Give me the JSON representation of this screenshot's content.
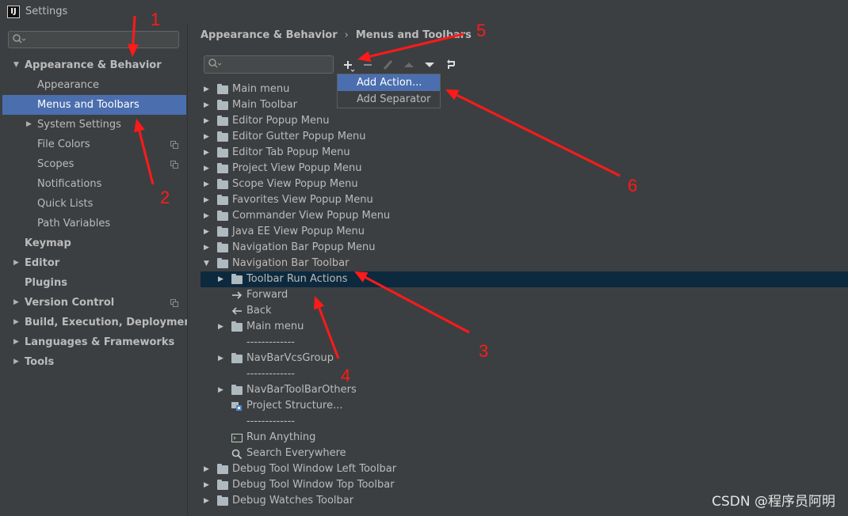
{
  "window": {
    "title": "Settings",
    "logo": "IJ"
  },
  "sidebar": {
    "search_placeholder": "",
    "items": [
      {
        "label": "Appearance & Behavior",
        "level": 0,
        "bold": true,
        "expand": "expanded"
      },
      {
        "label": "Appearance",
        "level": 1
      },
      {
        "label": "Menus and Toolbars",
        "level": 1,
        "selected": true
      },
      {
        "label": "System Settings",
        "level": 1,
        "expand": "collapsed"
      },
      {
        "label": "File Colors",
        "level": 1,
        "badge": true
      },
      {
        "label": "Scopes",
        "level": 1,
        "badge": true
      },
      {
        "label": "Notifications",
        "level": 1
      },
      {
        "label": "Quick Lists",
        "level": 1
      },
      {
        "label": "Path Variables",
        "level": 1
      },
      {
        "label": "Keymap",
        "level": 0,
        "bold": true
      },
      {
        "label": "Editor",
        "level": 0,
        "bold": true,
        "expand": "collapsed"
      },
      {
        "label": "Plugins",
        "level": 0,
        "bold": true
      },
      {
        "label": "Version Control",
        "level": 0,
        "bold": true,
        "expand": "collapsed",
        "badge": true
      },
      {
        "label": "Build, Execution, Deployment",
        "level": 0,
        "bold": true,
        "expand": "collapsed"
      },
      {
        "label": "Languages & Frameworks",
        "level": 0,
        "bold": true,
        "expand": "collapsed"
      },
      {
        "label": "Tools",
        "level": 0,
        "bold": true,
        "expand": "collapsed"
      }
    ]
  },
  "breadcrumb": {
    "parent": "Appearance & Behavior",
    "separator": "›",
    "current": "Menus and Toolbars"
  },
  "toolbar": {
    "buttons": [
      "plus-icon",
      "minus-icon",
      "edit-icon",
      "move-up-icon",
      "move-down-icon",
      "restore-icon"
    ]
  },
  "popup": {
    "items": [
      {
        "label": "Add Action...",
        "highlighted": true
      },
      {
        "label": "Add Separator"
      }
    ]
  },
  "tree": [
    {
      "label": "Main menu",
      "level": 0,
      "type": "folder",
      "expand": "collapsed"
    },
    {
      "label": "Main Toolbar",
      "level": 0,
      "type": "folder",
      "expand": "collapsed"
    },
    {
      "label": "Editor Popup Menu",
      "level": 0,
      "type": "folder",
      "expand": "collapsed"
    },
    {
      "label": "Editor Gutter Popup Menu",
      "level": 0,
      "type": "folder",
      "expand": "collapsed"
    },
    {
      "label": "Editor Tab Popup Menu",
      "level": 0,
      "type": "folder",
      "expand": "collapsed"
    },
    {
      "label": "Project View Popup Menu",
      "level": 0,
      "type": "folder",
      "expand": "collapsed"
    },
    {
      "label": "Scope View Popup Menu",
      "level": 0,
      "type": "folder",
      "expand": "collapsed"
    },
    {
      "label": "Favorites View Popup Menu",
      "level": 0,
      "type": "folder",
      "expand": "collapsed"
    },
    {
      "label": "Commander View Popup Menu",
      "level": 0,
      "type": "folder",
      "expand": "collapsed"
    },
    {
      "label": "Java EE View Popup Menu",
      "level": 0,
      "type": "folder",
      "expand": "collapsed"
    },
    {
      "label": "Navigation Bar Popup Menu",
      "level": 0,
      "type": "folder",
      "expand": "collapsed"
    },
    {
      "label": "Navigation Bar Toolbar",
      "level": 0,
      "type": "folder",
      "expand": "expanded"
    },
    {
      "label": "Toolbar Run Actions",
      "level": 1,
      "type": "folder",
      "expand": "collapsed",
      "selected": true
    },
    {
      "label": "Forward",
      "level": 1,
      "type": "forward"
    },
    {
      "label": "Back",
      "level": 1,
      "type": "back"
    },
    {
      "label": "Main menu",
      "level": 1,
      "type": "folder",
      "expand": "collapsed"
    },
    {
      "label": "-------------",
      "level": 1,
      "type": "separator"
    },
    {
      "label": "NavBarVcsGroup",
      "level": 1,
      "type": "folder",
      "expand": "collapsed"
    },
    {
      "label": "-------------",
      "level": 1,
      "type": "separator"
    },
    {
      "label": "NavBarToolBarOthers",
      "level": 1,
      "type": "folder",
      "expand": "collapsed"
    },
    {
      "label": "Project Structure...",
      "level": 1,
      "type": "project"
    },
    {
      "label": "-------------",
      "level": 1,
      "type": "separator"
    },
    {
      "label": "Run Anything",
      "level": 1,
      "type": "run"
    },
    {
      "label": "Search Everywhere",
      "level": 1,
      "type": "search"
    },
    {
      "label": "Debug Tool Window Left Toolbar",
      "level": 0,
      "type": "folder",
      "expand": "collapsed"
    },
    {
      "label": "Debug Tool Window Top Toolbar",
      "level": 0,
      "type": "folder",
      "expand": "collapsed"
    },
    {
      "label": "Debug Watches Toolbar",
      "level": 0,
      "type": "folder",
      "expand": "collapsed"
    }
  ],
  "annotations": {
    "color": "#ff1a1a",
    "labels": [
      "1",
      "2",
      "3",
      "4",
      "5",
      "6"
    ]
  },
  "watermark": "CSDN @程序员阿明",
  "colors": {
    "background": "#3c3f41",
    "selection": "#4b6eaf",
    "tree_selection": "#0d293e",
    "text": "#bbbbbb"
  }
}
